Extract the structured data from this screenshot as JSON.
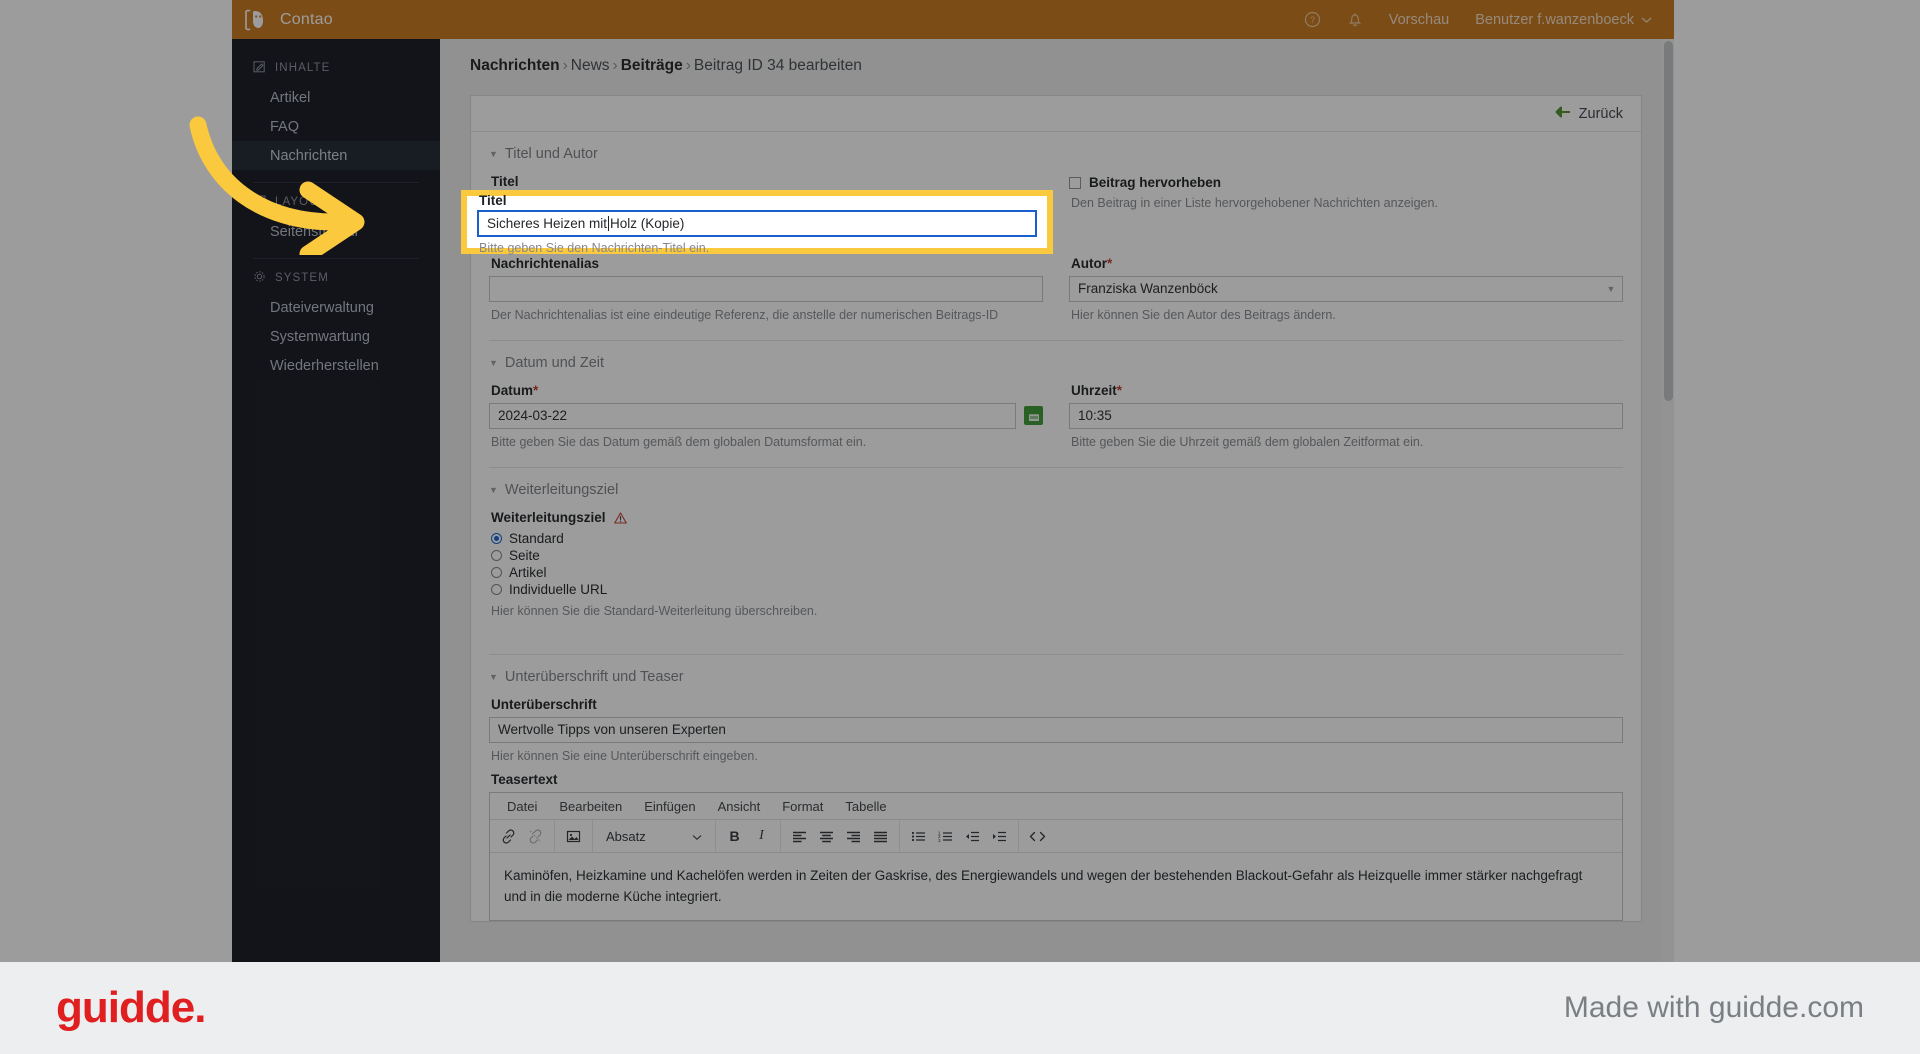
{
  "app": {
    "brand": "Contao",
    "topbar": {
      "help_icon": "help-circle-icon",
      "bell_icon": "bell-icon",
      "preview_label": "Vorschau",
      "user_label": "Benutzer f.wanzenboeck",
      "user_chevron": "chevron-down-icon"
    },
    "sidebar": {
      "groups": [
        {
          "title": "INHALTE",
          "icon": "pencil-square-icon",
          "items": [
            {
              "label": "Artikel",
              "active": false
            },
            {
              "label": "FAQ",
              "active": false
            },
            {
              "label": "Nachrichten",
              "active": true
            }
          ]
        },
        {
          "title": "LAYOUT",
          "icon": "layout-icon",
          "items": [
            {
              "label": "Seitenstruktur",
              "active": false
            }
          ]
        },
        {
          "title": "SYSTEM",
          "icon": "gear-icon",
          "items": [
            {
              "label": "Dateiverwaltung",
              "active": false
            },
            {
              "label": "Systemwartung",
              "active": false
            },
            {
              "label": "Wiederherstellen",
              "active": false
            }
          ]
        }
      ]
    }
  },
  "breadcrumb": {
    "part1": "Nachrichten",
    "part2": "News",
    "part3": "Beiträge",
    "part4": "Beitrag ID 34 bearbeiten",
    "separator": "›"
  },
  "panel": {
    "back_label": "Zurück",
    "back_icon": "arrow-left-icon"
  },
  "sections": {
    "title_author": {
      "legend": "Titel und Autor",
      "title_field": {
        "label": "Titel",
        "value": "Sicheres Heizen mit Holz (Kopie)",
        "hint": "Bitte geben Sie den Nachrichten-Titel ein."
      },
      "highlight_checkbox": {
        "label": "Beitrag hervorheben",
        "hint": "Den Beitrag in einer Liste hervorgehobener Nachrichten anzeigen.",
        "checked": false
      },
      "alias_field": {
        "label": "Nachrichtenalias",
        "value": "",
        "hint": "Der Nachrichtenalias ist eine eindeutige Referenz, die anstelle der numerischen Beitrags-ID"
      },
      "author_field": {
        "label": "Autor",
        "required": "*",
        "value": "Franziska Wanzenböck",
        "hint": "Hier können Sie den Autor des Beitrags ändern.",
        "arrow_icon": "chevron-down-icon"
      }
    },
    "date_time": {
      "legend": "Datum und Zeit",
      "date_field": {
        "label": "Datum",
        "required": "*",
        "value": "2024-03-22",
        "hint": "Bitte geben Sie das Datum gemäß dem globalen Datumsformat ein.",
        "calendar_icon": "calendar-icon"
      },
      "time_field": {
        "label": "Uhrzeit",
        "required": "*",
        "value": "10:35",
        "hint": "Bitte geben Sie die Uhrzeit gemäß dem globalen Zeitformat ein."
      }
    },
    "redirect": {
      "legend": "Weiterleitungsziel",
      "label": "Weiterleitungsziel",
      "warning_icon": "warning-triangle-icon",
      "options": [
        {
          "label": "Standard",
          "selected": true
        },
        {
          "label": "Seite",
          "selected": false
        },
        {
          "label": "Artikel",
          "selected": false
        },
        {
          "label": "Individuelle URL",
          "selected": false
        }
      ],
      "hint": "Hier können Sie die Standard-Weiterleitung überschreiben."
    },
    "subheadline": {
      "legend": "Unterüberschrift und Teaser",
      "sub_field": {
        "label": "Unterüberschrift",
        "value": "Wertvolle Tipps von unseren Experten",
        "hint": "Hier können Sie eine Unterüberschrift eingeben."
      },
      "teaser": {
        "label": "Teasertext",
        "menus": [
          "Datei",
          "Bearbeiten",
          "Einfügen",
          "Ansicht",
          "Format",
          "Tabelle"
        ],
        "format_select": "Absatz",
        "format_arrow_icon": "chevron-down-icon",
        "toolbar_icons": [
          "link-icon",
          "unlink-icon",
          "image-icon",
          "bold-icon",
          "italic-icon",
          "align-left-icon",
          "align-center-icon",
          "align-right-icon",
          "align-justify-icon",
          "bullet-list-icon",
          "numbered-list-icon",
          "outdent-icon",
          "indent-icon",
          "source-code-icon"
        ],
        "body": "Kaminöfen, Heizkamine und Kachelöfen werden in Zeiten der Gaskrise, des Energiewandels und wegen der bestehenden Blackout-Gefahr als Heizquelle immer stärker nachgefragt und in die moderne Küche integriert."
      }
    }
  },
  "footer": {
    "logo": "guidde.",
    "made_with": "Made with guidde.com"
  },
  "colors": {
    "brand_bar": "#c9761a",
    "sidebar": "#12161f",
    "highlight": "#fbc93d",
    "focus_border": "#1a5fd0",
    "guidde_red": "#e02020",
    "calendar_green": "#3a9a33"
  }
}
